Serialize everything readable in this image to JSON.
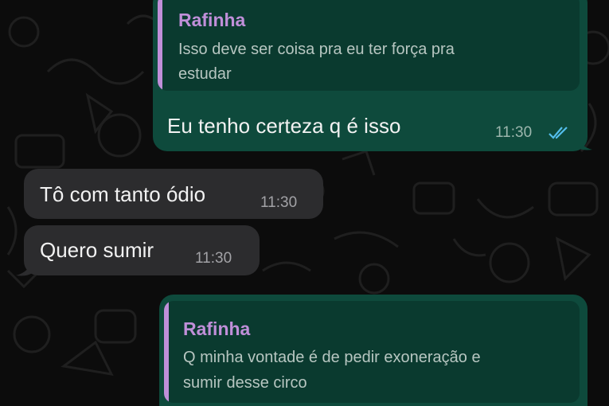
{
  "messages": [
    {
      "direction": "outgoing",
      "reply": {
        "author": "Rafinha",
        "text_line1": "Isso deve ser coisa pra eu ter força pra",
        "text_line2": "estudar"
      },
      "text": "Eu tenho certeza q é isso",
      "time": "11:30",
      "status": "read"
    },
    {
      "direction": "incoming",
      "text": "Tô com tanto ódio",
      "time": "11:30"
    },
    {
      "direction": "incoming",
      "text": "Quero sumir",
      "time": "11:30"
    },
    {
      "direction": "outgoing",
      "reply": {
        "author": "Rafinha",
        "text_line1": "Q minha vontade é de pedir exoneração e",
        "text_line2": "sumir desse circo"
      }
    }
  ],
  "colors": {
    "background": "#0c0c0c",
    "outgoing_bubble": "#0e4a3c",
    "incoming_bubble": "#2c2c2e",
    "quote_accent": "#c08fd9",
    "read_ticks": "#53bdeb"
  },
  "icons": {
    "read_receipt": "double-check-icon"
  }
}
